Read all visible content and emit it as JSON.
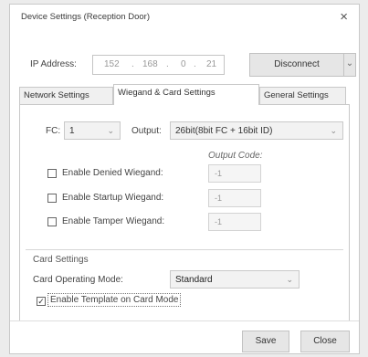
{
  "window": {
    "title": "Device Settings (Reception Door)",
    "close_glyph": "×"
  },
  "ip": {
    "label": "IP Address:",
    "octets": [
      "152",
      "168",
      "0",
      "21"
    ],
    "separator": "."
  },
  "connection": {
    "disconnect_label": "Disconnect",
    "dropdown_glyph": "⌄"
  },
  "tabs": [
    {
      "label": "Network Settings",
      "active": false
    },
    {
      "label": "Wiegand & Card Settings",
      "active": true
    },
    {
      "label": "General Settings",
      "active": false
    }
  ],
  "wiegand": {
    "fc_label": "FC:",
    "fc_value": "1",
    "output_label": "Output:",
    "output_value": "26bit(8bit FC + 16bit ID)",
    "output_code_header": "Output Code:",
    "options": [
      {
        "label": "Enable Denied Wiegand:",
        "checked": false,
        "code": "-1"
      },
      {
        "label": "Enable Startup Wiegand:",
        "checked": false,
        "code": "-1"
      },
      {
        "label": "Enable Tamper Wiegand:",
        "checked": false,
        "code": "-1"
      }
    ]
  },
  "card_settings": {
    "group_label": "Card Settings",
    "mode_label": "Card Operating Mode:",
    "mode_value": "Standard",
    "template_label": "Enable Template on Card Mode",
    "template_checked": true
  },
  "footer": {
    "save_label": "Save",
    "close_label": "Close"
  },
  "icons": {
    "dropdown_arrow": "⌄",
    "check_mark": "✓"
  }
}
